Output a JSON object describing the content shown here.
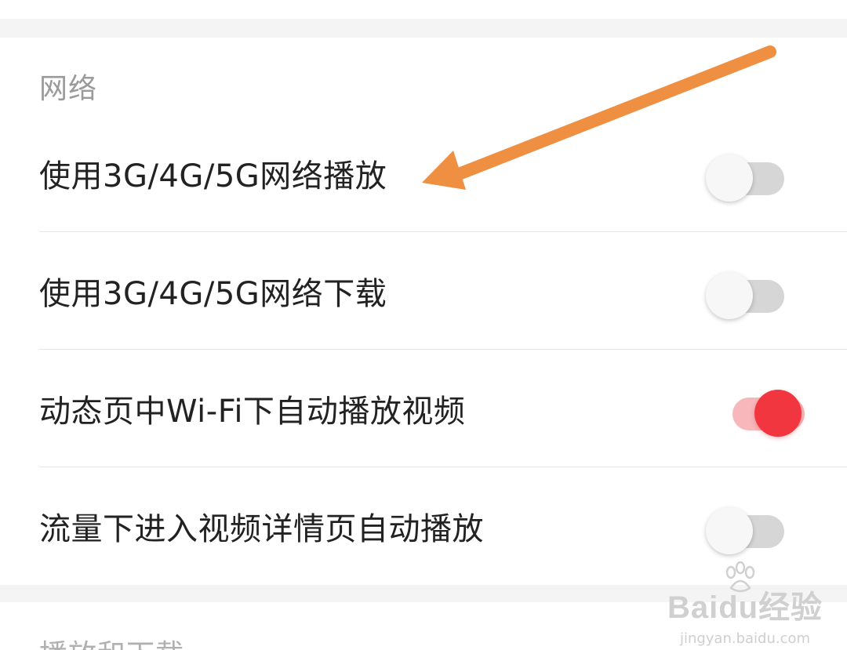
{
  "sections": {
    "network_title": "网络",
    "next_title": "播放和下载"
  },
  "rows": [
    {
      "label": "使用3G/4G/5G网络播放",
      "enabled": false
    },
    {
      "label": "使用3G/4G/5G网络下载",
      "enabled": false
    },
    {
      "label": "动态页中Wi-Fi下自动播放视频",
      "enabled": true
    },
    {
      "label": "流量下进入视频详情页自动播放",
      "enabled": false
    }
  ],
  "colors": {
    "accent": "#f2363f",
    "accent_track": "#f7b7bb",
    "arrow": "#ef8f42"
  },
  "watermark": {
    "logo_text": "Bai",
    "logo_text2": "du",
    "logo_cn": "经验",
    "url": "jingyan.baidu.com"
  }
}
